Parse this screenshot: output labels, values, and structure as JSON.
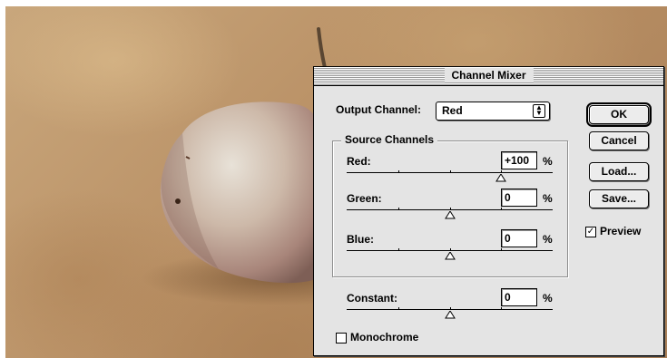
{
  "dialog": {
    "title": "Channel Mixer",
    "output_channel_label": "Output Channel:",
    "output_channel_value": "Red",
    "source_channels_label": "Source Channels",
    "channels": [
      {
        "label": "Red:",
        "value": "+100",
        "unit": "%",
        "level": 100
      },
      {
        "label": "Green:",
        "value": "0",
        "unit": "%",
        "level": 0
      },
      {
        "label": "Blue:",
        "value": "0",
        "unit": "%",
        "level": 0
      }
    ],
    "constant": {
      "label": "Constant:",
      "value": "0",
      "unit": "%",
      "level": 0
    },
    "monochrome": {
      "label": "Monochrome",
      "checked": false
    },
    "preview": {
      "label": "Preview",
      "checked": true
    },
    "buttons": {
      "ok": "OK",
      "cancel": "Cancel",
      "load": "Load...",
      "save": "Save..."
    }
  },
  "icons": {
    "popup_arrows": "up-down-arrows-icon",
    "slider_thumb": "triangle-thumb-icon"
  }
}
